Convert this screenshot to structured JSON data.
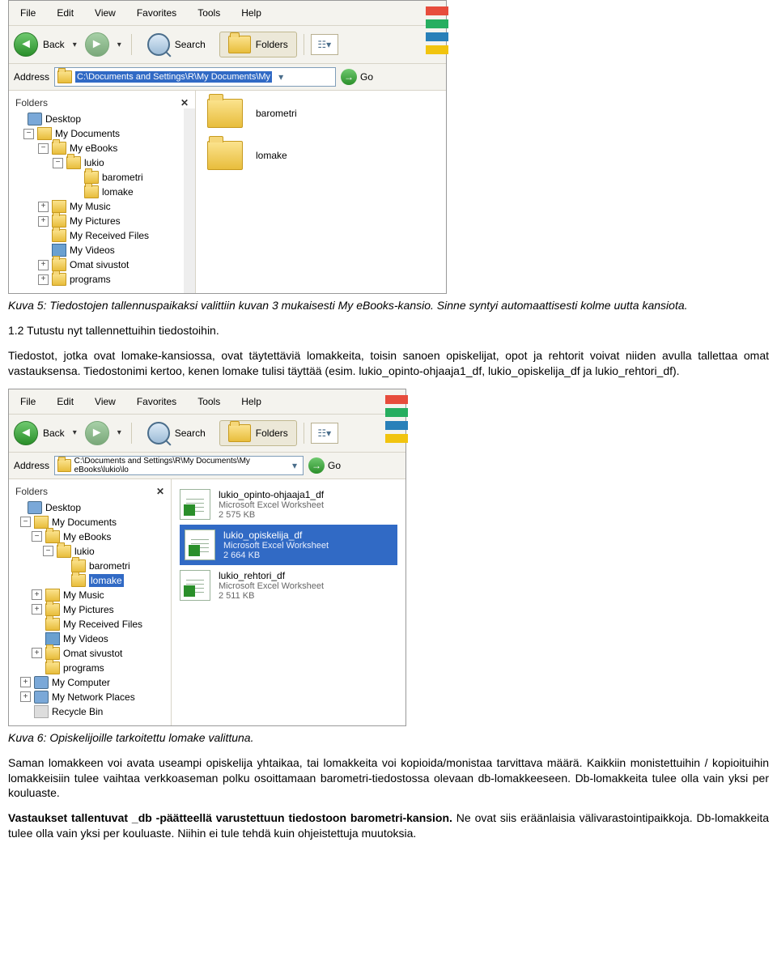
{
  "explorer1": {
    "menu": [
      "File",
      "Edit",
      "View",
      "Favorites",
      "Tools",
      "Help"
    ],
    "toolbar": {
      "back": "Back",
      "search": "Search",
      "folders": "Folders"
    },
    "address_label": "Address",
    "address_value": "C:\\Documents and Settings\\R\\My Documents\\My",
    "go": "Go",
    "folders_title": "Folders",
    "tree": {
      "desktop": "Desktop",
      "mydocs": "My Documents",
      "myebooks": "My eBooks",
      "lukio": "lukio",
      "barometri": "barometri",
      "lomake": "lomake",
      "mymusic": "My Music",
      "mypictures": "My Pictures",
      "myreceived": "My Received Files",
      "myvideos": "My Videos",
      "omat": "Omat sivustot",
      "programs": "programs"
    },
    "content": {
      "barometri": "barometri",
      "lomake": "lomake"
    }
  },
  "caption1": "Kuva 5: Tiedostojen tallennuspaikaksi valittiin kuvan 3 mukaisesti My eBooks-kansio. Sinne syntyi automaattisesti kolme uutta kansiota.",
  "heading12": "1.2 Tutustu nyt tallennettuihin tiedostoihin.",
  "para1": "Tiedostot, jotka ovat lomake-kansiossa, ovat täytettäviä lomakkeita, toisin sanoen opiskelijat, opot ja rehtorit voivat niiden avulla tallettaa omat vastauksensa. Tiedostonimi kertoo, kenen lomake tulisi täyttää (esim. lukio_opinto-ohjaaja1_df, lukio_opiskelija_df ja lukio_rehtori_df).",
  "explorer2": {
    "menu": [
      "File",
      "Edit",
      "View",
      "Favorites",
      "Tools",
      "Help"
    ],
    "toolbar": {
      "back": "Back",
      "search": "Search",
      "folders": "Folders"
    },
    "address_label": "Address",
    "address_value": "C:\\Documents and Settings\\R\\My Documents\\My eBooks\\lukio\\lo",
    "go": "Go",
    "folders_title": "Folders",
    "tree": {
      "desktop": "Desktop",
      "mydocs": "My Documents",
      "myebooks": "My eBooks",
      "lukio": "lukio",
      "barometri": "barometri",
      "lomake": "lomake",
      "mymusic": "My Music",
      "mypictures": "My Pictures",
      "myreceived": "My Received Files",
      "myvideos": "My Videos",
      "omat": "Omat sivustot",
      "programs": "programs",
      "mycomputer": "My Computer",
      "mynetwork": "My Network Places",
      "recycle": "Recycle Bin"
    },
    "files": [
      {
        "name": "lukio_opinto-ohjaaja1_df",
        "type": "Microsoft Excel Worksheet",
        "size": "2 575 KB",
        "selected": false
      },
      {
        "name": "lukio_opiskelija_df",
        "type": "Microsoft Excel Worksheet",
        "size": "2 664 KB",
        "selected": true
      },
      {
        "name": "lukio_rehtori_df",
        "type": "Microsoft Excel Worksheet",
        "size": "2 511 KB",
        "selected": false
      }
    ]
  },
  "caption2": "Kuva 6: Opiskelijoille tarkoitettu lomake valittuna.",
  "para2": "Saman lomakkeen voi avata useampi opiskelija yhtaikaa, tai lomakkeita voi kopioida/monistaa tarvittava määrä. Kaikkiin monistettuihin / kopioituihin lomakkeisiin tulee vaihtaa verkkoaseman polku osoittamaan barometri-tiedostossa olevaan db-lomakkeeseen. Db-lomakkeita tulee olla vain yksi per kouluaste.",
  "para3a": "Vastaukset tallentuvat _db -päätteellä varustettuun tiedostoon barometri-kansion.",
  "para3b": " Ne ovat siis eräänlaisia välivarastointipaikkoja. Db-lomakkeita tulee olla vain yksi per kouluaste. Niihin ei tule tehdä kuin ohjeistettuja muutoksia."
}
